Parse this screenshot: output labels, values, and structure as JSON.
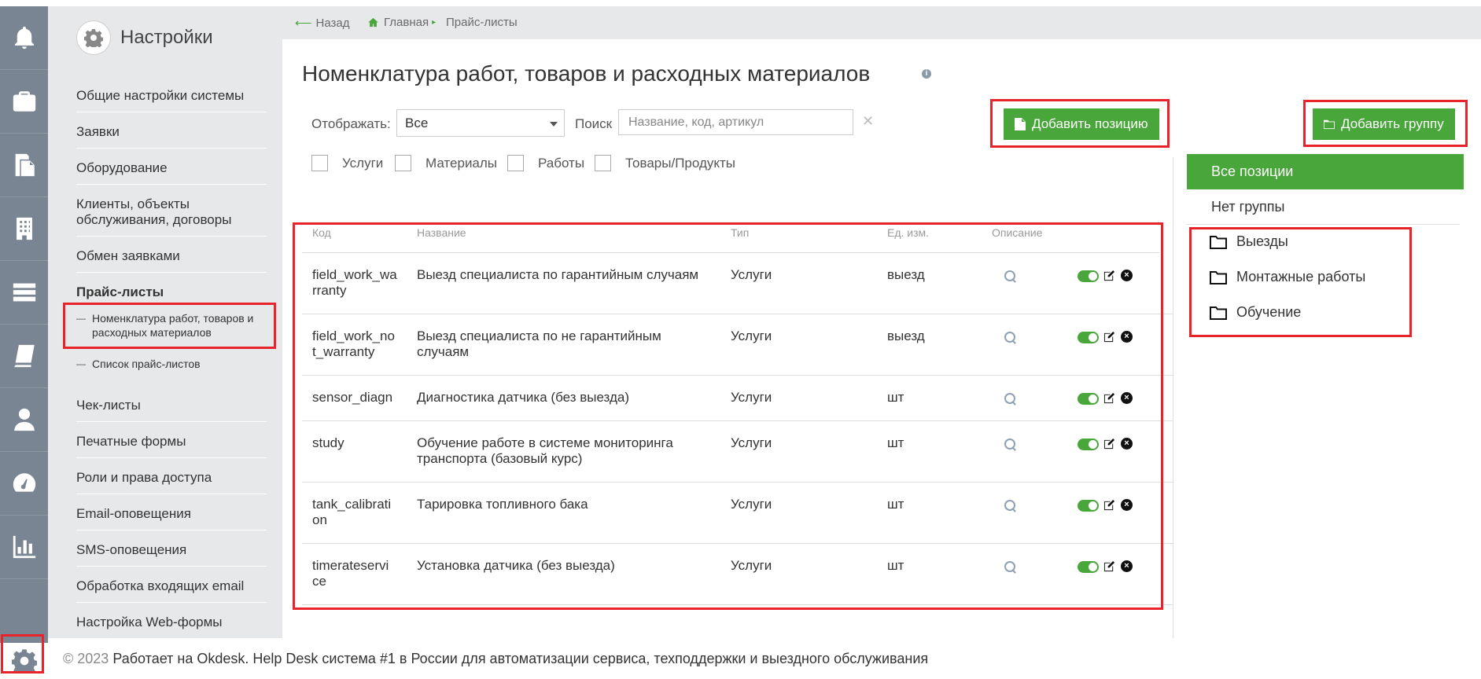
{
  "rail": {
    "items": [
      "bell-icon",
      "briefcase-icon",
      "documents-icon",
      "building-icon",
      "list-icon",
      "book-icon",
      "user-icon",
      "dashboard-icon",
      "chart-icon"
    ],
    "settings_icon": "gear-icon"
  },
  "settings_menu": {
    "title": "Настройки",
    "items": [
      "Общие настройки системы",
      "Заявки",
      "Оборудование",
      "Клиенты, объекты обслуживания, договоры",
      "Обмен заявками",
      "Прайс-листы",
      "Чек-листы",
      "Печатные формы",
      "Роли и права доступа",
      "Email-оповещения",
      "SMS-оповещения",
      "Обработка входящих email",
      "Настройка Web-формы"
    ],
    "sub_items": [
      "Номенклатура работ, товаров и расходных материалов",
      "Список прайс-листов"
    ]
  },
  "breadcrumb": {
    "back": "Назад",
    "home": "Главная",
    "current": "Прайс-листы"
  },
  "page": {
    "title": "Номенклатура работ, товаров и расходных материалов",
    "display_label": "Отображать:",
    "display_value": "Все",
    "search_label": "Поиск",
    "search_placeholder": "Название, код, артикул",
    "add_position": "Добавить позицию",
    "add_group": "Добавить группу",
    "filters": [
      "Услуги",
      "Материалы",
      "Работы",
      "Товары/Продукты"
    ]
  },
  "table": {
    "headers": [
      "Код",
      "Название",
      "Тип",
      "Ед. изм.",
      "Описание"
    ],
    "rows": [
      {
        "code_1": "field_work_wa",
        "code_2": "rranty",
        "name_1": "Выезд специалиста по гарантийным случаям",
        "name_2": "",
        "type": "Услуги",
        "unit": "выезд"
      },
      {
        "code_1": "field_work_no",
        "code_2": "t_warranty",
        "name_1": "Выезд специалиста по не гарантийным",
        "name_2": "случаям",
        "type": "Услуги",
        "unit": "выезд"
      },
      {
        "code_1": "sensor_diagn",
        "code_2": "",
        "name_1": "Диагностика датчика (без выезда)",
        "name_2": "",
        "type": "Услуги",
        "unit": "шт"
      },
      {
        "code_1": "study",
        "code_2": "",
        "name_1": "Обучение работе в системе мониторинга",
        "name_2": "транспорта (базовый курс)",
        "type": "Услуги",
        "unit": "шт"
      },
      {
        "code_1": "tank_calibrati",
        "code_2": "on",
        "name_1": "Тарировка топливного бака",
        "name_2": "",
        "type": "Услуги",
        "unit": "шт"
      },
      {
        "code_1": "timerateservi",
        "code_2": "ce",
        "name_1": "Установка датчика (без выезда)",
        "name_2": "",
        "type": "Услуги",
        "unit": "шт"
      }
    ]
  },
  "groups": {
    "all": "Все позиции",
    "none": "Нет группы",
    "folders": [
      "Выезды",
      "Монтажные работы",
      "Обучение"
    ]
  },
  "footer": {
    "copyright": "© 2023",
    "text": "Работает на Okdesk. Help Desk система #1 в России для автоматизации сервиса, техподдержки и выездного обслуживания"
  },
  "colors": {
    "accent": "#49a63a",
    "rail": "#798592",
    "highlight": "#e8232a"
  }
}
